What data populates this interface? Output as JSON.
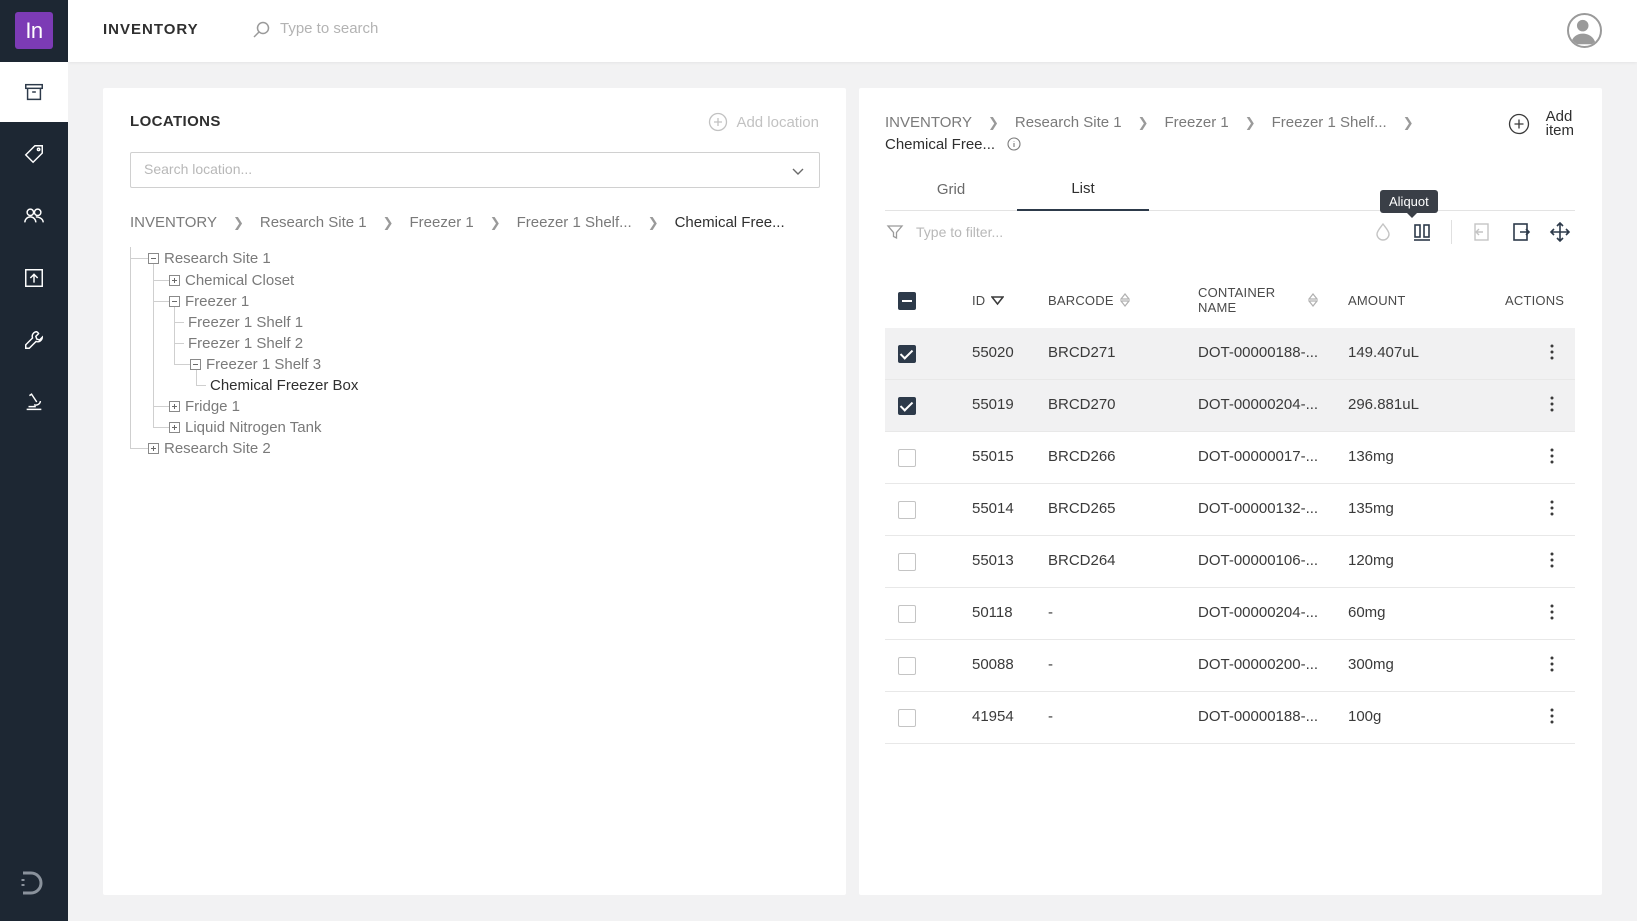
{
  "app": {
    "logo_text": "In",
    "title": "INVENTORY"
  },
  "topbar": {
    "search_placeholder": "Type to search"
  },
  "sidebar": {
    "items": [
      {
        "name": "archive-icon",
        "active": true
      },
      {
        "name": "tag-icon",
        "active": false
      },
      {
        "name": "users-icon",
        "active": false
      },
      {
        "name": "upload-icon",
        "active": false
      },
      {
        "name": "wrench-icon",
        "active": false
      },
      {
        "name": "microscope-icon",
        "active": false
      }
    ],
    "bottom_icon": "brand-d-icon"
  },
  "locations": {
    "title": "LOCATIONS",
    "add_label": "Add location",
    "search_placeholder": "Search location...",
    "breadcrumb": [
      "INVENTORY",
      "Research Site 1",
      "Freezer 1",
      "Freezer 1 Shelf...",
      "Chemical Free..."
    ],
    "tree": [
      {
        "label": "Research Site 1",
        "toggle": "minus"
      },
      {
        "label": "Chemical Closet",
        "toggle": "plus"
      },
      {
        "label": "Freezer 1",
        "toggle": "minus"
      },
      {
        "label": "Freezer 1 Shelf 1",
        "toggle": "none"
      },
      {
        "label": "Freezer 1 Shelf 2",
        "toggle": "none"
      },
      {
        "label": "Freezer 1 Shelf 3",
        "toggle": "minus"
      },
      {
        "label": "Chemical Freezer Box",
        "toggle": "none",
        "selected": true
      },
      {
        "label": "Fridge 1",
        "toggle": "plus"
      },
      {
        "label": "Liquid Nitrogen Tank",
        "toggle": "plus"
      },
      {
        "label": "Research Site 2",
        "toggle": "plus"
      }
    ]
  },
  "detail": {
    "breadcrumb": [
      "INVENTORY",
      "Research Site 1",
      "Freezer 1",
      "Freezer 1 Shelf...",
      "Chemical Free..."
    ],
    "add_item_line1": "Add",
    "add_item_line2": "item",
    "tabs": [
      "Grid",
      "List"
    ],
    "active_tab": "List",
    "tooltip": "Aliquot",
    "filter_placeholder": "Type to filter...",
    "toolbar": [
      "drop-icon",
      "aliquot-icon",
      "check-in-icon",
      "check-out-icon",
      "move-icon"
    ],
    "columns": {
      "id": "ID",
      "barcode": "BARCODE",
      "container_line1": "CONTAINER",
      "container_line2": "NAME",
      "amount": "AMOUNT",
      "actions": "ACTIONS"
    },
    "rows": [
      {
        "id": "55020",
        "barcode": "BRCD271",
        "container": "DOT-00000188-...",
        "amount": "149.407uL",
        "checked": true
      },
      {
        "id": "55019",
        "barcode": "BRCD270",
        "container": "DOT-00000204-...",
        "amount": "296.881uL",
        "checked": true
      },
      {
        "id": "55015",
        "barcode": "BRCD266",
        "container": "DOT-00000017-...",
        "amount": "136mg",
        "checked": false
      },
      {
        "id": "55014",
        "barcode": "BRCD265",
        "container": "DOT-00000132-...",
        "amount": "135mg",
        "checked": false
      },
      {
        "id": "55013",
        "barcode": "BRCD264",
        "container": "DOT-00000106-...",
        "amount": "120mg",
        "checked": false
      },
      {
        "id": "50118",
        "barcode": "-",
        "container": "DOT-00000204-...",
        "amount": "60mg",
        "checked": false
      },
      {
        "id": "50088",
        "barcode": "-",
        "container": "DOT-00000200-...",
        "amount": "300mg",
        "checked": false
      },
      {
        "id": "41954",
        "barcode": "-",
        "container": "DOT-00000188-...",
        "amount": "100g",
        "checked": false
      }
    ]
  },
  "colors": {
    "rail": "#1d2733",
    "logo": "#7c3bb5",
    "accent": "#2d3a4a"
  }
}
